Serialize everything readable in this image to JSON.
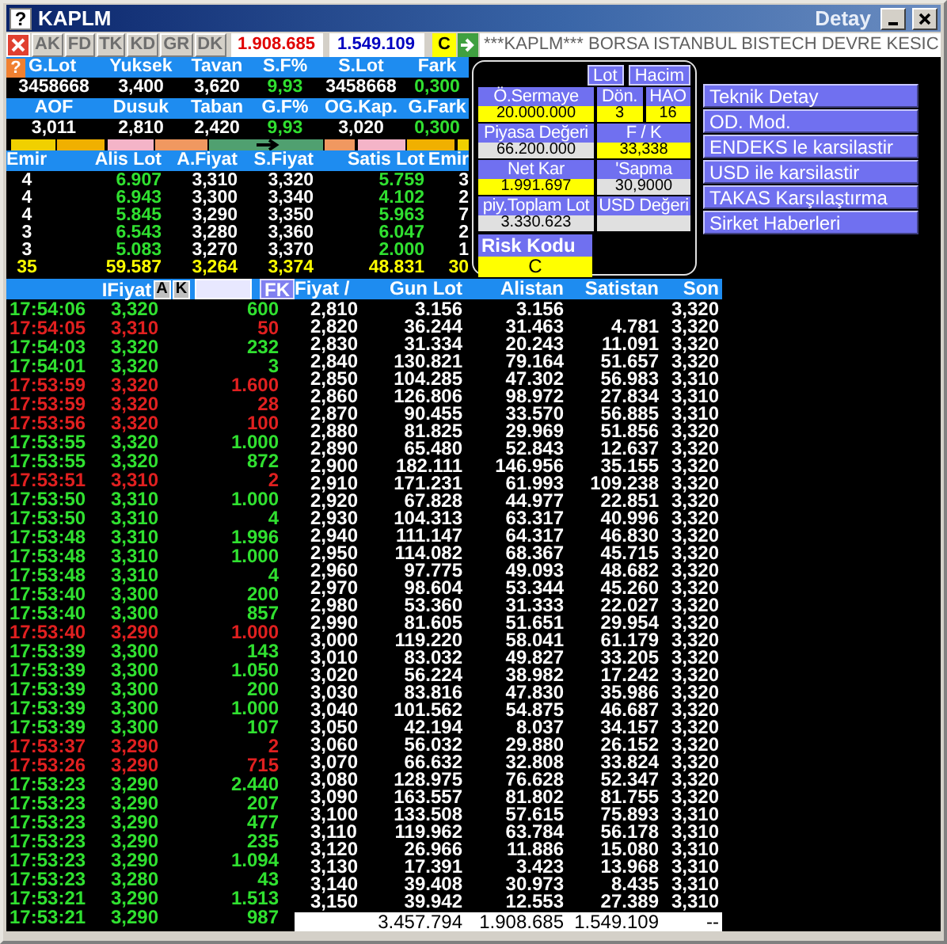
{
  "window": {
    "title": "KAPLM",
    "help_glyph": "?",
    "detail_title": "Detay"
  },
  "toolbar": {
    "buttons": [
      {
        "label": "AK",
        "disabled": true
      },
      {
        "label": "FD",
        "disabled": true
      },
      {
        "label": "TK",
        "disabled": true
      },
      {
        "label": "KD",
        "disabled": true
      },
      {
        "label": "GR",
        "disabled": true
      },
      {
        "label": "DK",
        "disabled": true
      }
    ],
    "bid_total": "1.908.685",
    "ask_total": "1.549.109",
    "risk_badge": "C",
    "ticker": "***KAPLM*** BORSA ISTANBUL BISTECH DEVRE KESIC"
  },
  "summary": {
    "help_glyph": "?",
    "blocks": [
      {
        "headers": [
          "G.Lot",
          "Yuksek",
          "Tavan",
          "S.F%",
          "S.Lot",
          "Fark"
        ],
        "values": [
          {
            "text": "3458668",
            "positive": false
          },
          {
            "text": "3,400",
            "positive": false
          },
          {
            "text": "3,620",
            "positive": false
          },
          {
            "text": "9,93",
            "positive": true
          },
          {
            "text": "3458668",
            "positive": false
          },
          {
            "text": "0,300",
            "positive": true
          }
        ]
      },
      {
        "headers": [
          "AOF",
          "Dusuk",
          "Taban",
          "G.F%",
          "OG.Kap.",
          "G.Fark"
        ],
        "values": [
          {
            "text": "3,011",
            "positive": false
          },
          {
            "text": "2,810",
            "positive": false
          },
          {
            "text": "2,420",
            "positive": false
          },
          {
            "text": "9,93",
            "positive": true
          },
          {
            "text": "3,020",
            "positive": false
          },
          {
            "text": "0,300",
            "positive": true
          }
        ]
      }
    ]
  },
  "order_book": {
    "columns": [
      "Emir",
      "Alis Lot",
      "A.Fiyat",
      "S.Fiyat",
      "Satis Lot",
      "Emir"
    ],
    "rows": [
      [
        "4",
        "6.907",
        "3,310",
        "3,320",
        "5.759",
        "3"
      ],
      [
        "4",
        "6.943",
        "3,300",
        "3,340",
        "4.102",
        "2"
      ],
      [
        "4",
        "5.845",
        "3,290",
        "3,350",
        "5.963",
        "7"
      ],
      [
        "3",
        "6.543",
        "3,280",
        "3,360",
        "6.047",
        "2"
      ],
      [
        "3",
        "5.083",
        "3,270",
        "3,370",
        "2.000",
        "1"
      ]
    ],
    "totals": [
      "35",
      "59.587",
      "3,264",
      "3,374",
      "48.831",
      "30"
    ]
  },
  "detail_panel": {
    "toggles": [
      "Lot",
      "Hacim"
    ],
    "rows": [
      [
        {
          "label": "Ö.Sermaye",
          "value": "20.000.000",
          "highlighted": true
        },
        {
          "label": "Dön.",
          "value": "3",
          "highlighted": true
        },
        {
          "label": "HAO",
          "value": "16",
          "highlighted": true
        }
      ],
      [
        {
          "label": "Piyasa Değeri",
          "value": "66.200.000",
          "highlighted": false
        },
        {
          "label": "F / K",
          "value": "33,338",
          "highlighted": true
        }
      ],
      [
        {
          "label": "Net Kar",
          "value": "1.991.697",
          "highlighted": true
        },
        {
          "label": "'Sapma",
          "value": "30,9000",
          "highlighted": false
        }
      ],
      [
        {
          "label": "piy.Toplam Lot",
          "value": "3.330.623",
          "highlighted": false
        },
        {
          "label": "USD Değeri",
          "highlighted": false
        }
      ]
    ],
    "risk": {
      "label": "Risk Kodu",
      "value": "C"
    }
  },
  "actions": [
    "Teknik Detay",
    "OD. Mod.",
    "ENDEKS le karsilastir",
    "USD ile karsilastir",
    "TAKAS Karşılaştırma",
    "Sirket Haberleri"
  ],
  "trades": {
    "label": "IFiyat",
    "buttons": [
      "A",
      "K"
    ],
    "filter_button": "FK",
    "rows": [
      {
        "time": "17:54:06",
        "price": "3,320",
        "quantity": "600",
        "sell": false
      },
      {
        "time": "17:54:05",
        "price": "3,310",
        "quantity": "50",
        "sell": true
      },
      {
        "time": "17:54:03",
        "price": "3,320",
        "quantity": "232",
        "sell": false
      },
      {
        "time": "17:54:01",
        "price": "3,320",
        "quantity": "3",
        "sell": false
      },
      {
        "time": "17:53:59",
        "price": "3,320",
        "quantity": "1.600",
        "sell": true
      },
      {
        "time": "17:53:59",
        "price": "3,320",
        "quantity": "28",
        "sell": true
      },
      {
        "time": "17:53:56",
        "price": "3,320",
        "quantity": "100",
        "sell": true
      },
      {
        "time": "17:53:55",
        "price": "3,320",
        "quantity": "1.000",
        "sell": false
      },
      {
        "time": "17:53:55",
        "price": "3,320",
        "quantity": "872",
        "sell": false
      },
      {
        "time": "17:53:51",
        "price": "3,310",
        "quantity": "2",
        "sell": true
      },
      {
        "time": "17:53:50",
        "price": "3,310",
        "quantity": "1.000",
        "sell": false
      },
      {
        "time": "17:53:50",
        "price": "3,310",
        "quantity": "4",
        "sell": false
      },
      {
        "time": "17:53:48",
        "price": "3,310",
        "quantity": "1.996",
        "sell": false
      },
      {
        "time": "17:53:48",
        "price": "3,310",
        "quantity": "1.000",
        "sell": false
      },
      {
        "time": "17:53:48",
        "price": "3,310",
        "quantity": "4",
        "sell": false
      },
      {
        "time": "17:53:40",
        "price": "3,300",
        "quantity": "200",
        "sell": false
      },
      {
        "time": "17:53:40",
        "price": "3,300",
        "quantity": "857",
        "sell": false
      },
      {
        "time": "17:53:40",
        "price": "3,290",
        "quantity": "1.000",
        "sell": true
      },
      {
        "time": "17:53:39",
        "price": "3,300",
        "quantity": "143",
        "sell": false
      },
      {
        "time": "17:53:39",
        "price": "3,300",
        "quantity": "1.050",
        "sell": false
      },
      {
        "time": "17:53:39",
        "price": "3,300",
        "quantity": "200",
        "sell": false
      },
      {
        "time": "17:53:39",
        "price": "3,300",
        "quantity": "1.000",
        "sell": false
      },
      {
        "time": "17:53:39",
        "price": "3,300",
        "quantity": "107",
        "sell": false
      },
      {
        "time": "17:53:37",
        "price": "3,290",
        "quantity": "2",
        "sell": true
      },
      {
        "time": "17:53:26",
        "price": "3,290",
        "quantity": "715",
        "sell": true
      },
      {
        "time": "17:53:23",
        "price": "3,290",
        "quantity": "2.440",
        "sell": false
      },
      {
        "time": "17:53:23",
        "price": "3,290",
        "quantity": "207",
        "sell": false
      },
      {
        "time": "17:53:23",
        "price": "3,290",
        "quantity": "477",
        "sell": false
      },
      {
        "time": "17:53:23",
        "price": "3,290",
        "quantity": "235",
        "sell": false
      },
      {
        "time": "17:53:23",
        "price": "3,290",
        "quantity": "1.094",
        "sell": false
      },
      {
        "time": "17:53:23",
        "price": "3,280",
        "quantity": "43",
        "sell": false
      },
      {
        "time": "17:53:21",
        "price": "3,290",
        "quantity": "1.513",
        "sell": false
      },
      {
        "time": "17:53:21",
        "price": "3,290",
        "quantity": "987",
        "sell": false
      }
    ]
  },
  "price_table": {
    "columns": [
      "Fiyat /",
      "Gun Lot",
      "Alistan",
      "Satistan",
      "Son"
    ],
    "rows": [
      {
        "price": "2,810",
        "gun_lot": "3.156",
        "alistan": "3.156",
        "son": "3,320"
      },
      {
        "price": "2,820",
        "gun_lot": "36.244",
        "alistan": "31.463",
        "satistan": "4.781",
        "son": "3,320"
      },
      {
        "price": "2,830",
        "gun_lot": "31.334",
        "alistan": "20.243",
        "satistan": "11.091",
        "son": "3,320"
      },
      {
        "price": "2,840",
        "gun_lot": "130.821",
        "alistan": "79.164",
        "satistan": "51.657",
        "son": "3,320"
      },
      {
        "price": "2,850",
        "gun_lot": "104.285",
        "alistan": "47.302",
        "satistan": "56.983",
        "son": "3,310"
      },
      {
        "price": "2,860",
        "gun_lot": "126.806",
        "alistan": "98.972",
        "satistan": "27.834",
        "son": "3,310"
      },
      {
        "price": "2,870",
        "gun_lot": "90.455",
        "alistan": "33.570",
        "satistan": "56.885",
        "son": "3,310"
      },
      {
        "price": "2,880",
        "gun_lot": "81.825",
        "alistan": "29.969",
        "satistan": "51.856",
        "son": "3,320"
      },
      {
        "price": "2,890",
        "gun_lot": "65.480",
        "alistan": "52.843",
        "satistan": "12.637",
        "son": "3,320"
      },
      {
        "price": "2,900",
        "gun_lot": "182.111",
        "alistan": "146.956",
        "satistan": "35.155",
        "son": "3,320"
      },
      {
        "price": "2,910",
        "gun_lot": "171.231",
        "alistan": "61.993",
        "satistan": "109.238",
        "son": "3,320"
      },
      {
        "price": "2,920",
        "gun_lot": "67.828",
        "alistan": "44.977",
        "satistan": "22.851",
        "son": "3,320"
      },
      {
        "price": "2,930",
        "gun_lot": "104.313",
        "alistan": "63.317",
        "satistan": "40.996",
        "son": "3,320"
      },
      {
        "price": "2,940",
        "gun_lot": "111.147",
        "alistan": "64.317",
        "satistan": "46.830",
        "son": "3,320"
      },
      {
        "price": "2,950",
        "gun_lot": "114.082",
        "alistan": "68.367",
        "satistan": "45.715",
        "son": "3,320"
      },
      {
        "price": "2,960",
        "gun_lot": "97.775",
        "alistan": "49.093",
        "satistan": "48.682",
        "son": "3,320"
      },
      {
        "price": "2,970",
        "gun_lot": "98.604",
        "alistan": "53.344",
        "satistan": "45.260",
        "son": "3,320"
      },
      {
        "price": "2,980",
        "gun_lot": "53.360",
        "alistan": "31.333",
        "satistan": "22.027",
        "son": "3,320"
      },
      {
        "price": "2,990",
        "gun_lot": "81.605",
        "alistan": "51.651",
        "satistan": "29.954",
        "son": "3,320"
      },
      {
        "price": "3,000",
        "gun_lot": "119.220",
        "alistan": "58.041",
        "satistan": "61.179",
        "son": "3,320"
      },
      {
        "price": "3,010",
        "gun_lot": "83.032",
        "alistan": "49.827",
        "satistan": "33.205",
        "son": "3,320"
      },
      {
        "price": "3,020",
        "gun_lot": "56.224",
        "alistan": "38.982",
        "satistan": "17.242",
        "son": "3,320"
      },
      {
        "price": "3,030",
        "gun_lot": "83.816",
        "alistan": "47.830",
        "satistan": "35.986",
        "son": "3,320"
      },
      {
        "price": "3,040",
        "gun_lot": "101.562",
        "alistan": "54.875",
        "satistan": "46.687",
        "son": "3,320"
      },
      {
        "price": "3,050",
        "gun_lot": "42.194",
        "alistan": "8.037",
        "satistan": "34.157",
        "son": "3,320"
      },
      {
        "price": "3,060",
        "gun_lot": "56.032",
        "alistan": "29.880",
        "satistan": "26.152",
        "son": "3,320"
      },
      {
        "price": "3,070",
        "gun_lot": "66.632",
        "alistan": "32.808",
        "satistan": "33.824",
        "son": "3,320"
      },
      {
        "price": "3,080",
        "gun_lot": "128.975",
        "alistan": "76.628",
        "satistan": "52.347",
        "son": "3,320"
      },
      {
        "price": "3,090",
        "gun_lot": "163.557",
        "alistan": "81.802",
        "satistan": "81.755",
        "son": "3,320"
      },
      {
        "price": "3,100",
        "gun_lot": "133.508",
        "alistan": "57.615",
        "satistan": "75.893",
        "son": "3,310"
      },
      {
        "price": "3,110",
        "gun_lot": "119.962",
        "alistan": "63.784",
        "satistan": "56.178",
        "son": "3,310"
      },
      {
        "price": "3,120",
        "gun_lot": "26.966",
        "alistan": "11.886",
        "satistan": "15.080",
        "son": "3,310"
      },
      {
        "price": "3,130",
        "gun_lot": "17.391",
        "alistan": "3.423",
        "satistan": "13.968",
        "son": "3,310"
      },
      {
        "price": "3,140",
        "gun_lot": "39.408",
        "alistan": "30.973",
        "satistan": "8.435",
        "son": "3,310"
      },
      {
        "price": "3,150",
        "gun_lot": "39.942",
        "alistan": "12.553",
        "satistan": "27.389",
        "son": "3,310"
      }
    ],
    "totals": {
      "gun_lot": "3.457.794",
      "alistan": "1.908.685",
      "satistan": "1.549.109",
      "son": "--"
    }
  }
}
